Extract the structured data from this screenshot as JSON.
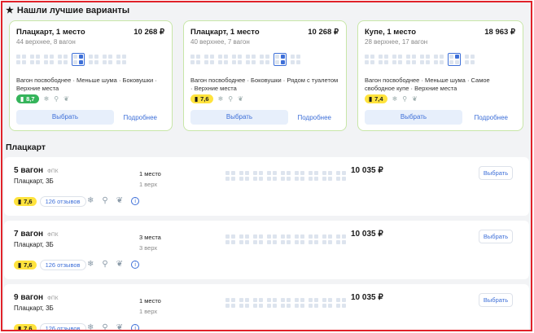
{
  "best": {
    "title": "Нашли лучшие варианты",
    "cards": [
      {
        "title": "Плацкарт, 1 место",
        "price": "10 268 ₽",
        "sub": "44 верхнее, 8 вагон",
        "tags": "Вагон посвободнее · Меньше шума · Боковушки · Верхние места",
        "rating": "8,7",
        "rating_color": "#35b45b",
        "choose": "Выбрать",
        "more": "Подробнее"
      },
      {
        "title": "Плацкарт, 1 место",
        "price": "10 268 ₽",
        "sub": "40 верхнее, 7 вагон",
        "tags": "Вагон посвободнее · Боковушки · Рядом с туалетом · Верхние места",
        "rating": "7,6",
        "rating_color": "#ffe33d",
        "choose": "Выбрать",
        "more": "Подробнее"
      },
      {
        "title": "Купе, 1 место",
        "price": "18 963 ₽",
        "sub": "28 верхнее, 17 вагон",
        "tags": "Вагон посвободнее · Меньше шума · Самое свободное купе · Верхние места",
        "rating": "7,4",
        "rating_color": "#ffe33d",
        "choose": "Выбрать",
        "more": "Подробнее"
      }
    ]
  },
  "section": {
    "title": "Плацкарт"
  },
  "wagons": [
    {
      "num": "5 вагон",
      "fpk": "ФПК",
      "type": "Плацкарт, 3Б",
      "seats": "1 место",
      "seats_sub": "1 верх",
      "price": "10 035 ₽",
      "choose": "Выбрать",
      "rating": "7,6",
      "reviews": "126 отзывов"
    },
    {
      "num": "7 вагон",
      "fpk": "ФПК",
      "type": "Плацкарт, 3Б",
      "seats": "3 места",
      "seats_sub": "3 верх",
      "price": "10 035 ₽",
      "choose": "Выбрать",
      "rating": "7,6",
      "reviews": "126 отзывов"
    },
    {
      "num": "9 вагон",
      "fpk": "ФПК",
      "type": "Плацкарт, 3Б",
      "seats": "1 место",
      "seats_sub": "1 верх",
      "price": "10 035 ₽",
      "choose": "Выбрать",
      "rating": "7,6",
      "reviews": "126 отзывов"
    }
  ],
  "icons": {
    "star": "star-icon",
    "snowflake": "snowflake-icon",
    "toilet": "toilet-icon",
    "pet": "paw-icon",
    "info": "info-icon",
    "train": "train-icon"
  },
  "colors": {
    "accent": "#3d6fd8",
    "frame": "#e0222a",
    "best_border": "#c8e6a8"
  }
}
